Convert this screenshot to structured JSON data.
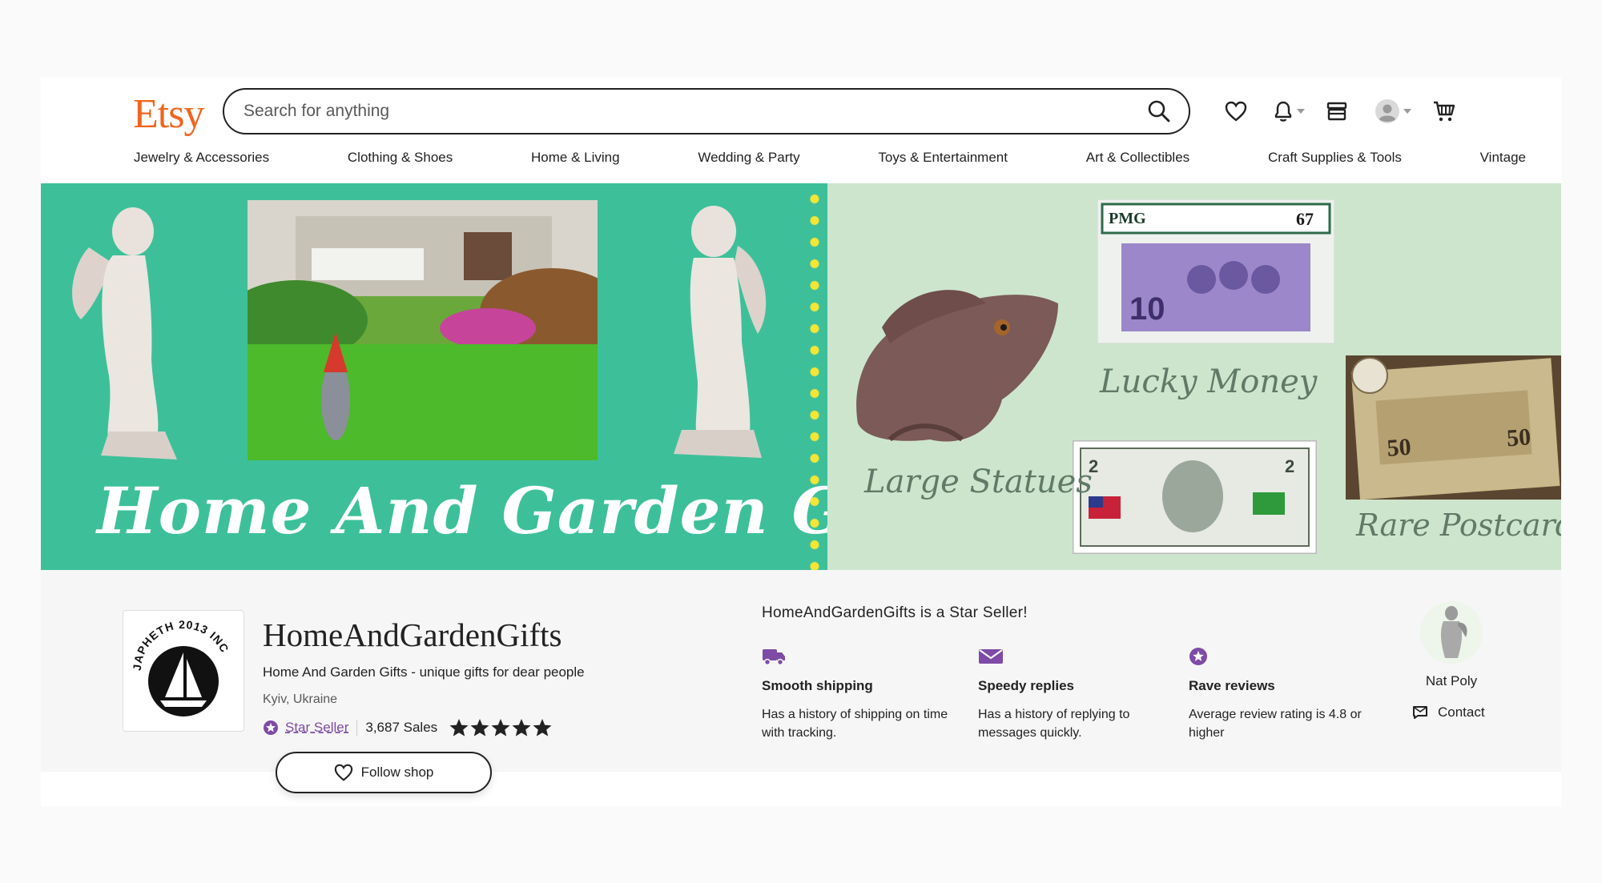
{
  "header": {
    "logo": "Etsy",
    "search_placeholder": "Search for anything"
  },
  "nav": {
    "items": [
      "Jewelry & Accessories",
      "Clothing & Shoes",
      "Home & Living",
      "Wedding & Party",
      "Toys & Entertainment",
      "Art & Collectibles",
      "Craft Supplies & Tools",
      "Vintage"
    ]
  },
  "banner": {
    "title": "Home And Garden Gifts",
    "label_statues": "Large Statues",
    "label_money": "Lucky Money",
    "label_postcards": "Rare Postcards"
  },
  "shop": {
    "logo_text": "JAPHETH 2013 INC",
    "name": "HomeAndGardenGifts",
    "tagline": "Home And Garden Gifts - unique gifts for dear people",
    "location": "Kyiv, Ukraine",
    "star_seller_label": "Star Seller",
    "sales": "3,687 Sales",
    "rating_stars": 5,
    "follow_label": "Follow shop"
  },
  "star_seller": {
    "heading": "HomeAndGardenGifts is a Star Seller!",
    "features": [
      {
        "title": "Smooth shipping",
        "desc": "Has a history of shipping on time with tracking.",
        "icon": "truck-icon"
      },
      {
        "title": "Speedy replies",
        "desc": "Has a history of replying to messages quickly.",
        "icon": "envelope-icon"
      },
      {
        "title": "Rave reviews",
        "desc": "Average review rating is 4.8 or higher",
        "icon": "star-badge-icon"
      }
    ]
  },
  "owner": {
    "name": "Nat Poly",
    "contact_label": "Contact"
  },
  "colors": {
    "brand": "#f1641e",
    "banner_green": "#3dc09a",
    "banner_mint": "#cde5cd",
    "star_seller_purple": "#7e4ba6"
  }
}
